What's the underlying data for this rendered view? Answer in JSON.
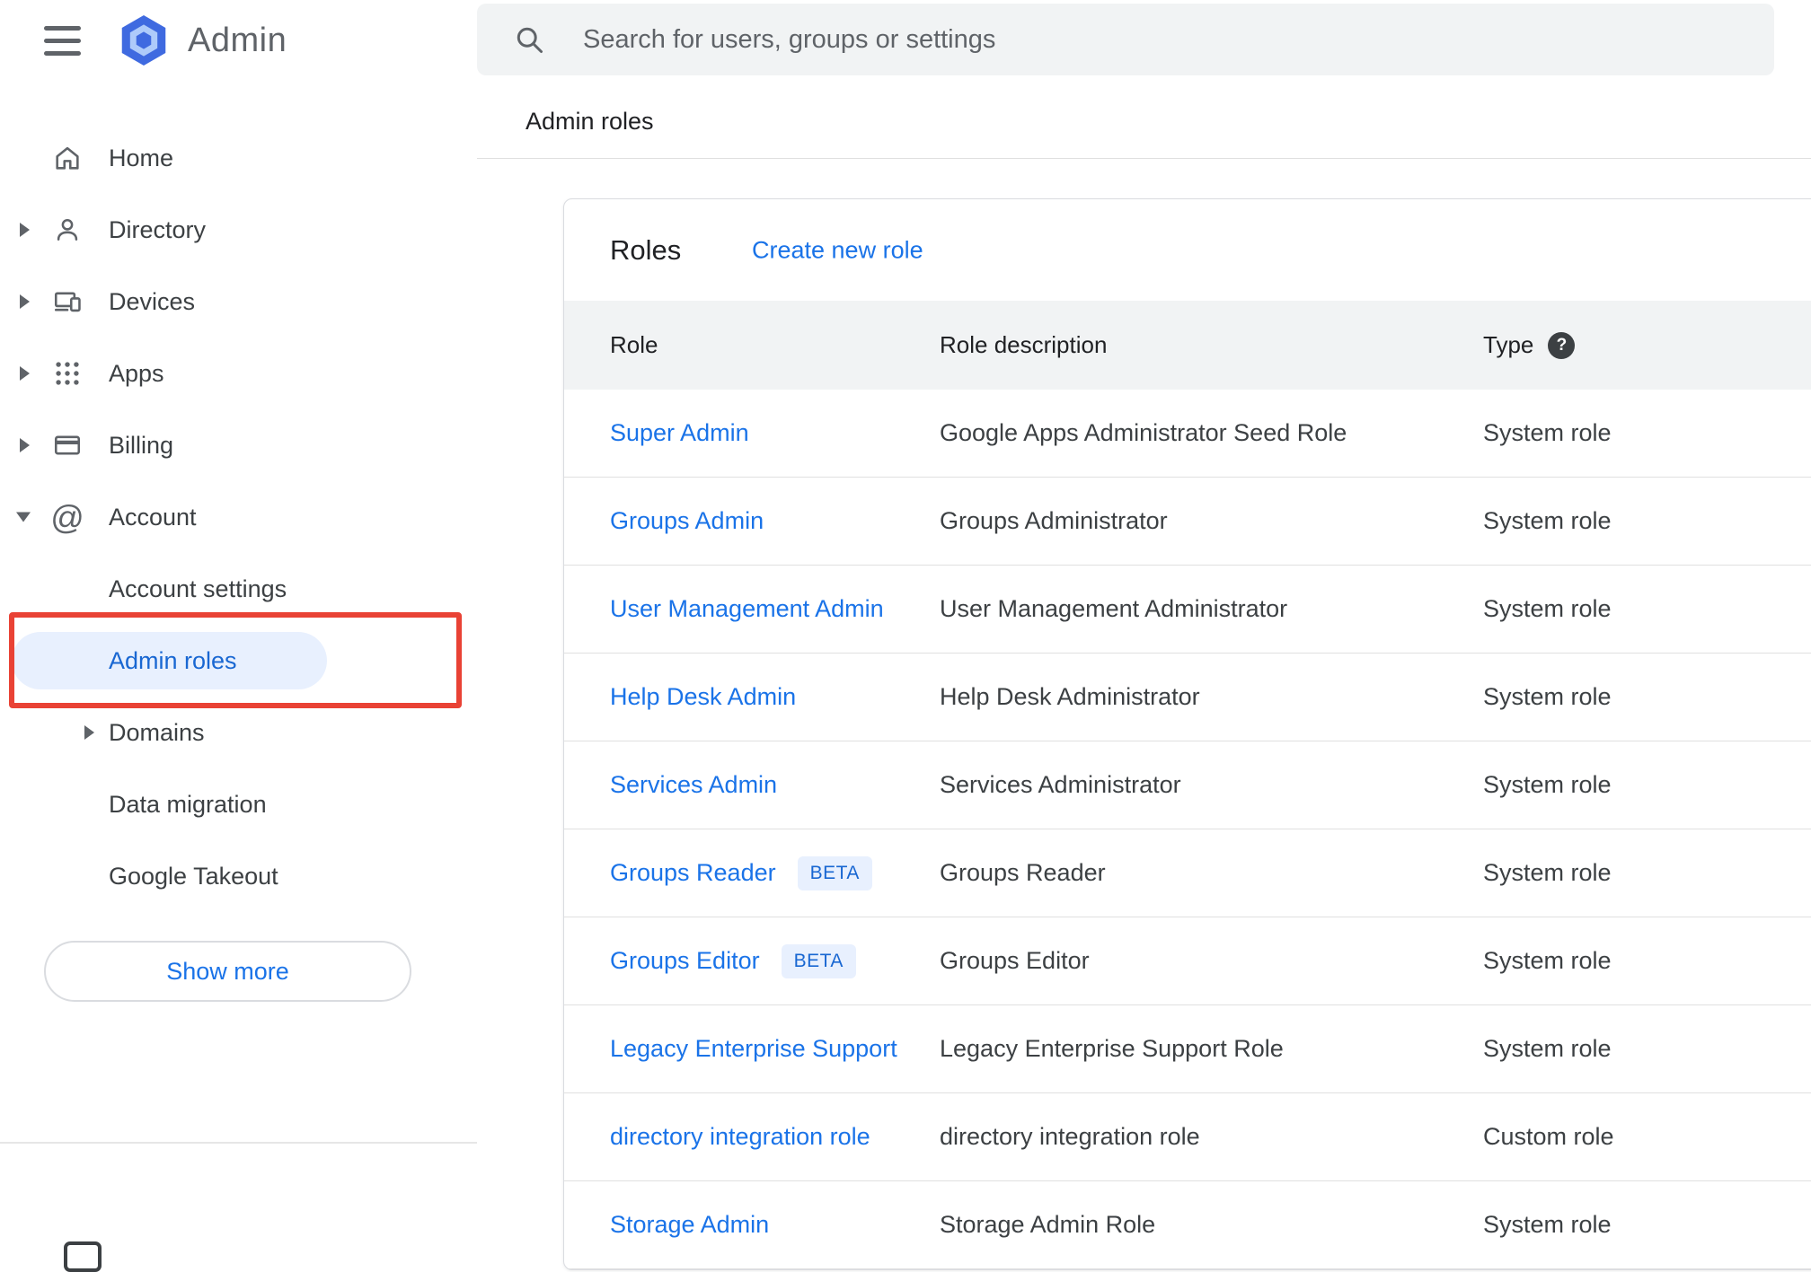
{
  "brand": {
    "name": "Admin"
  },
  "header": {
    "search_placeholder": "Search for users, groups or settings",
    "breadcrumb": "Admin roles"
  },
  "sidebar": {
    "items": [
      {
        "label": "Home"
      },
      {
        "label": "Directory"
      },
      {
        "label": "Devices"
      },
      {
        "label": "Apps"
      },
      {
        "label": "Billing"
      },
      {
        "label": "Account"
      }
    ],
    "account_children": [
      {
        "label": "Account settings"
      },
      {
        "label": "Admin roles"
      },
      {
        "label": "Domains"
      },
      {
        "label": "Data migration"
      },
      {
        "label": "Google Takeout"
      }
    ],
    "show_more_label": "Show more"
  },
  "main": {
    "card_title": "Roles",
    "create_link": "Create new role",
    "table": {
      "columns": [
        "Role",
        "Role description",
        "Type"
      ],
      "rows": [
        {
          "role": "Super Admin",
          "description": "Google Apps Administrator Seed Role",
          "type": "System role"
        },
        {
          "role": "Groups Admin",
          "description": "Groups Administrator",
          "type": "System role"
        },
        {
          "role": "User Management Admin",
          "description": "User Management Administrator",
          "type": "System role"
        },
        {
          "role": "Help Desk Admin",
          "description": "Help Desk Administrator",
          "type": "System role"
        },
        {
          "role": "Services Admin",
          "description": "Services Administrator",
          "type": "System role"
        },
        {
          "role": "Groups Reader",
          "beta": "BETA",
          "description": "Groups Reader",
          "type": "System role"
        },
        {
          "role": "Groups Editor",
          "beta": "BETA",
          "description": "Groups Editor",
          "type": "System role"
        },
        {
          "role": "Legacy Enterprise Support",
          "description": "Legacy Enterprise Support Role",
          "type": "System role"
        },
        {
          "role": "directory integration role",
          "description": "directory integration role",
          "type": "Custom role"
        },
        {
          "role": "Storage Admin",
          "description": "Storage Admin Role",
          "type": "System role"
        }
      ]
    }
  },
  "icons": {
    "help_glyph": "?",
    "account_glyph": "@"
  },
  "colors": {
    "link_blue": "#1a73e8",
    "active_blue": "#1967d2",
    "active_pill_bg": "#e8f0fe",
    "annotation_red": "#e94235",
    "beta_bg": "#e8f0fe",
    "table_header_bg": "#f1f3f4",
    "search_bg": "#f1f3f4"
  }
}
